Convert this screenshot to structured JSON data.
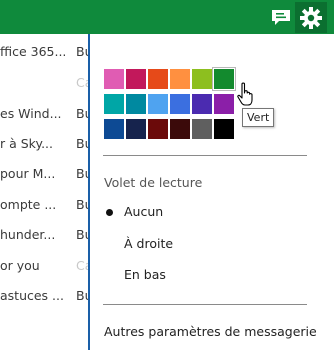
{
  "topbar": {
    "bg": "#0f8a3c",
    "icons": [
      "chat-icon",
      "gear-icon"
    ]
  },
  "maillist": {
    "rows": [
      {
        "subject": "ffice 365...",
        "from": "Bu"
      },
      {
        "subject": "",
        "from": "Ca",
        "faint": true
      },
      {
        "subject": "es Wind...",
        "from": "Bu"
      },
      {
        "subject": "r à Sky...",
        "from": "Bu"
      },
      {
        "subject": " pour M...",
        "from": "Bu"
      },
      {
        "subject": "ompte ...",
        "from": "Bu"
      },
      {
        "subject": "hunder...",
        "from": "Bu"
      },
      {
        "subject": "or you",
        "from": "Ca",
        "faint": true
      },
      {
        "subject": "astuces ...",
        "from": "Bu"
      }
    ]
  },
  "themes": {
    "colors": [
      "#e05cb3",
      "#c2185b",
      "#e64a19",
      "#ff9040",
      "#8dbf1f",
      "#138a2e",
      "#00a6a6",
      "#0089a0",
      "#4fa3f0",
      "#3b6fe0",
      "#4b2bb0",
      "#8b1fa8",
      "#0d4a94",
      "#16234d",
      "#6b0a0a",
      "#3b0a0a",
      "#5f5f5f",
      "#000000"
    ],
    "selected_index": 5,
    "tooltip": "Vert"
  },
  "reading_pane": {
    "title": "Volet de lecture",
    "options": [
      {
        "label": "Aucun",
        "selected": true
      },
      {
        "label": "À droite",
        "selected": false
      },
      {
        "label": "En bas",
        "selected": false
      }
    ]
  },
  "more_settings": "Autres paramètres de messagerie"
}
